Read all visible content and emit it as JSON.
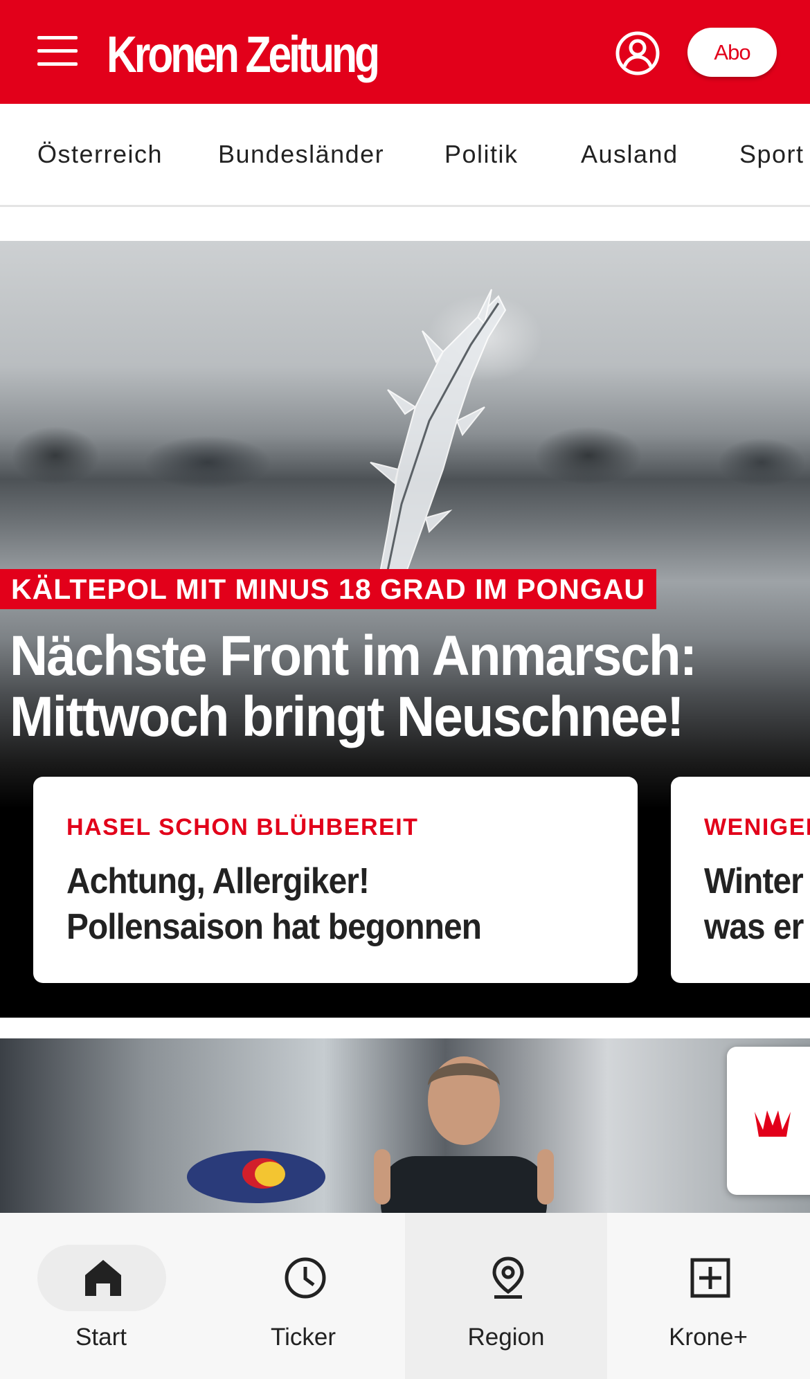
{
  "header": {
    "logo_text": "Kronen Zeitung",
    "abo_label": "Abo",
    "brand_color": "#e2001a"
  },
  "nav": {
    "items": [
      {
        "label": "Österreich"
      },
      {
        "label": "Bundesländer"
      },
      {
        "label": "Politik"
      },
      {
        "label": "Ausland"
      },
      {
        "label": "Sport"
      }
    ]
  },
  "hero": {
    "kicker": "KÄLTEPOL MIT MINUS 18 GRAD IM PONGAU",
    "headline_line1": "Nächste Front im Anmarsch:",
    "headline_line2": "Mittwoch bringt Neuschnee!"
  },
  "cards": [
    {
      "kicker": "HASEL SCHON BLÜHBEREIT",
      "title_line1": "Achtung, Allergiker!",
      "title_line2": "Pollensaison hat begonnen"
    },
    {
      "kicker": "WENIGER",
      "title_line1": "Winter",
      "title_line2": "was er"
    }
  ],
  "bottom_nav": {
    "tabs": [
      {
        "label": "Start",
        "icon": "home-icon"
      },
      {
        "label": "Ticker",
        "icon": "clock-icon"
      },
      {
        "label": "Region",
        "icon": "location-pin-icon"
      },
      {
        "label": "Krone+",
        "icon": "plus-box-icon"
      }
    ]
  }
}
